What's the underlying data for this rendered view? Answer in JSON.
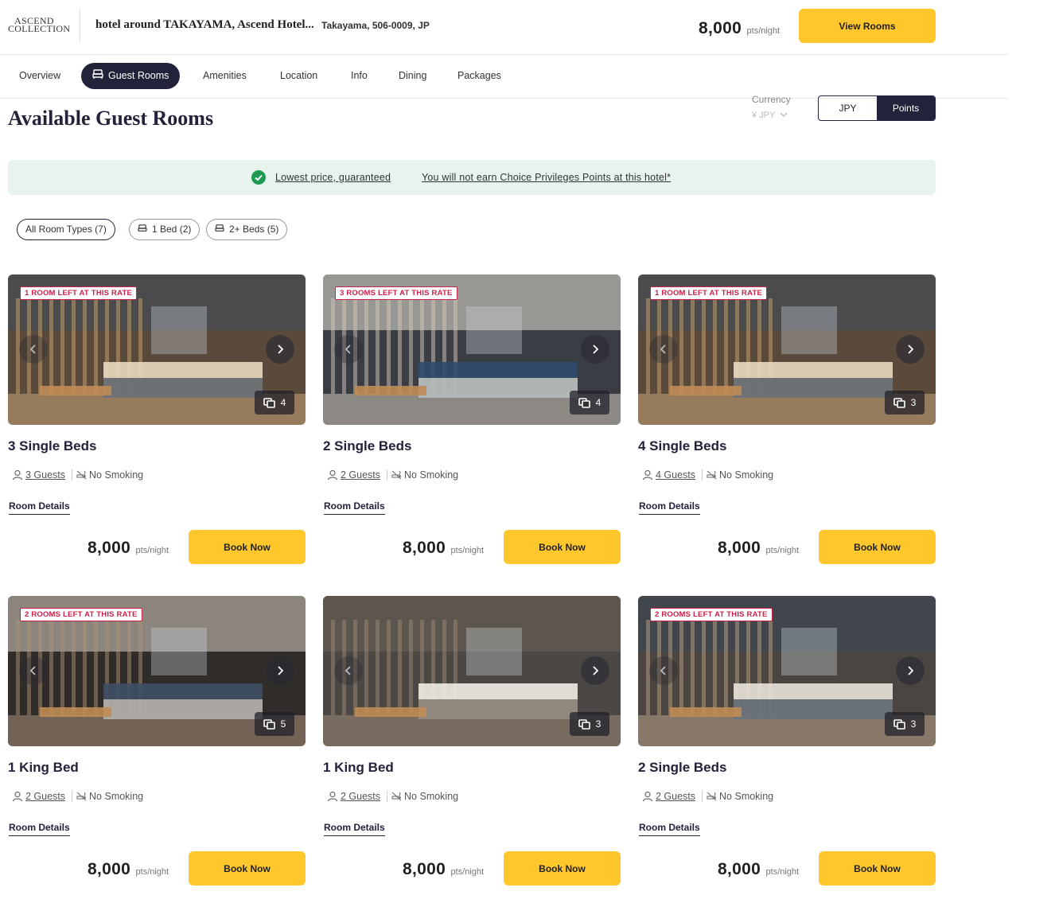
{
  "header": {
    "logo_line1": "ASCEND",
    "logo_line2": "COLLECTION",
    "hotel_name": "hotel around TAKAYAMA, Ascend Hotel...",
    "address": "Takayama, 506-0009, JP",
    "price": "8,000",
    "price_unit": "pts/night",
    "view_rooms_label": "View Rooms"
  },
  "nav": {
    "items": [
      "Overview",
      "Guest Rooms",
      "Amenities",
      "Location",
      "Info",
      "Dining",
      "Packages"
    ],
    "active": "Guest Rooms"
  },
  "section": {
    "title": "Available Guest Rooms",
    "currency_label": "Currency",
    "currency_value": "¥ JPY",
    "toggle": [
      "JPY",
      "Points"
    ],
    "toggle_selected": "Points"
  },
  "banner": {
    "link1": "Lowest price, guaranteed",
    "link2": "You will not earn Choice Privileges Points at this hotel*"
  },
  "filters": [
    {
      "label": "All Room Types (7)",
      "selected": true,
      "icon": "none"
    },
    {
      "label": "1 Bed (2)",
      "selected": false,
      "icon": "bed-icon"
    },
    {
      "label": "2+ Beds (5)",
      "selected": false,
      "icon": "bed-icon"
    }
  ],
  "cards": [
    {
      "badge": "1 ROOM LEFT AT THIS RATE",
      "photos": "4",
      "title": "3 Single Beds",
      "guests": "3 Guests",
      "smoking": "No Smoking",
      "details": "Room Details",
      "price": "8,000",
      "unit": "pts/night",
      "book": "Book Now"
    },
    {
      "badge": "3 ROOMS LEFT AT THIS RATE",
      "photos": "4",
      "title": "2 Single Beds",
      "guests": "2 Guests",
      "smoking": "No Smoking",
      "details": "Room Details",
      "price": "8,000",
      "unit": "pts/night",
      "book": "Book Now"
    },
    {
      "badge": "1 ROOM LEFT AT THIS RATE",
      "photos": "3",
      "title": "4 Single Beds",
      "guests": "4 Guests",
      "smoking": "No Smoking",
      "details": "Room Details",
      "price": "8,000",
      "unit": "pts/night",
      "book": "Book Now"
    },
    {
      "badge": "2 ROOMS LEFT AT THIS RATE",
      "photos": "5",
      "title": "1 King Bed",
      "guests": "2 Guests",
      "smoking": "No Smoking",
      "details": "Room Details",
      "price": "8,000",
      "unit": "pts/night",
      "book": "Book Now"
    },
    {
      "badge": "",
      "photos": "3",
      "title": "1 King Bed",
      "guests": "2 Guests",
      "smoking": "No Smoking",
      "details": "Room Details",
      "price": "8,000",
      "unit": "pts/night",
      "book": "Book Now"
    },
    {
      "badge": "2 ROOMS LEFT AT THIS RATE",
      "photos": "3",
      "title": "2 Single Beds",
      "guests": "2 Guests",
      "smoking": "No Smoking",
      "details": "Room Details",
      "price": "8,000",
      "unit": "pts/night",
      "book": "Book Now"
    }
  ],
  "colors": {
    "brand_dark": "#22223a",
    "cta_yellow": "#ffc72c",
    "badge_red": "#c8234a",
    "banner_green": "#e8f3ee",
    "check_green": "#1f9a52"
  }
}
